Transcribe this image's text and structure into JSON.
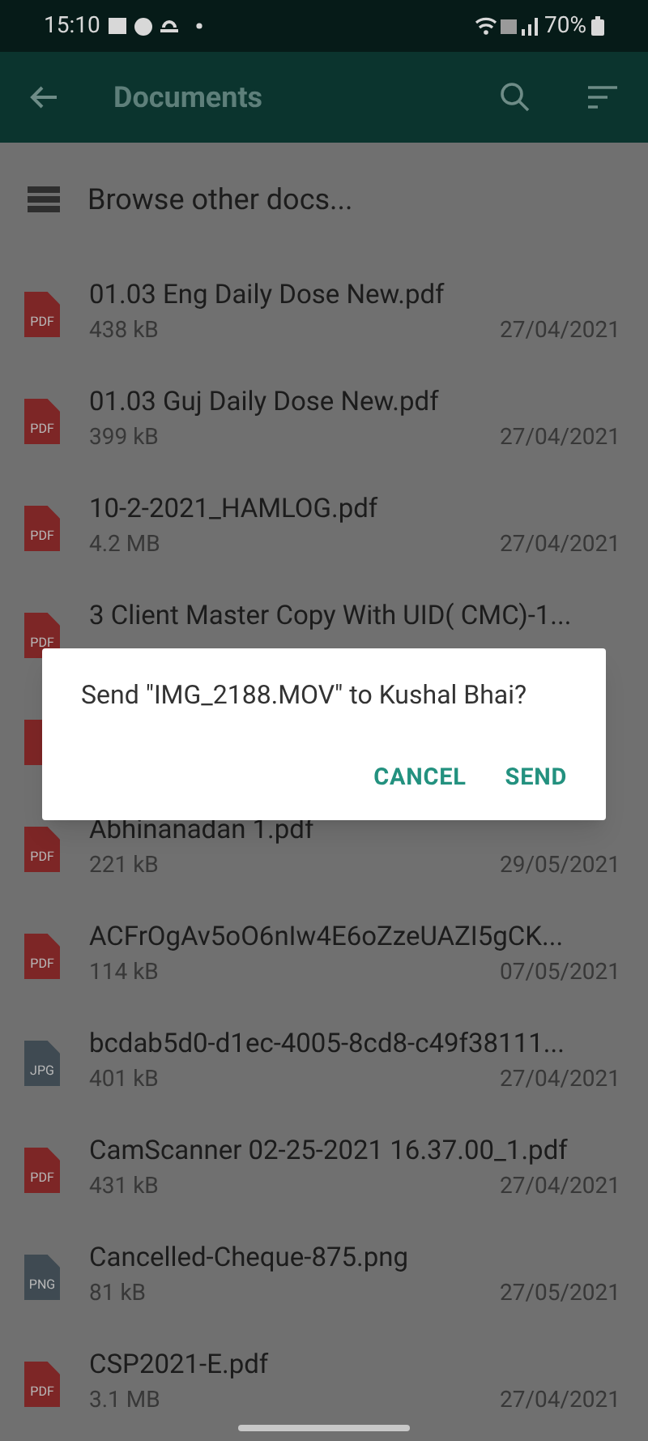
{
  "status_bar": {
    "time": "15:10",
    "battery": "70%"
  },
  "header": {
    "title": "Documents"
  },
  "browse": {
    "label": "Browse other docs..."
  },
  "files": [
    {
      "kind": "pdf",
      "label": "PDF",
      "name": "01.03 Eng Daily Dose New.pdf",
      "size": "438 kB",
      "date": "27/04/2021"
    },
    {
      "kind": "pdf",
      "label": "PDF",
      "name": "01.03 Guj Daily Dose New.pdf",
      "size": "399 kB",
      "date": "27/04/2021"
    },
    {
      "kind": "pdf",
      "label": "PDF",
      "name": "10-2-2021_HAMLOG.pdf",
      "size": "4.2 MB",
      "date": "27/04/2021"
    },
    {
      "kind": "pdf",
      "label": "PDF",
      "name": "3 Client Master Copy With UID( CMC)-1..."
    },
    {
      "kind": "pdf"
    },
    {
      "kind": "pdf",
      "label": "PDF",
      "name": "Abhinanadan 1.pdf",
      "size": "221 kB",
      "date": "29/05/2021"
    },
    {
      "kind": "pdf",
      "label": "PDF",
      "name": "ACFrOgAv5oO6nIw4E6oZzeUAZI5gCK...",
      "size": "114 kB",
      "date": "07/05/2021"
    },
    {
      "kind": "image",
      "label": "JPG",
      "name": "bcdab5d0-d1ec-4005-8cd8-c49f38111...",
      "size": "401 kB",
      "date": "27/04/2021"
    },
    {
      "kind": "pdf",
      "label": "PDF",
      "name": "CamScanner 02-25-2021 16.37.00_1.pdf",
      "size": "431 kB",
      "date": "27/04/2021"
    },
    {
      "kind": "image",
      "label": "PNG",
      "name": "Cancelled-Cheque-875.png",
      "size": "81 kB",
      "date": "27/05/2021"
    },
    {
      "kind": "pdf",
      "label": "PDF",
      "name": "CSP2021-E.pdf",
      "size": "3.1 MB",
      "date": "27/04/2021"
    }
  ],
  "dialog": {
    "message": "Send \"IMG_2188.MOV\" to Kushal Bhai?",
    "buttons": [
      "CANCEL",
      "SEND"
    ]
  }
}
